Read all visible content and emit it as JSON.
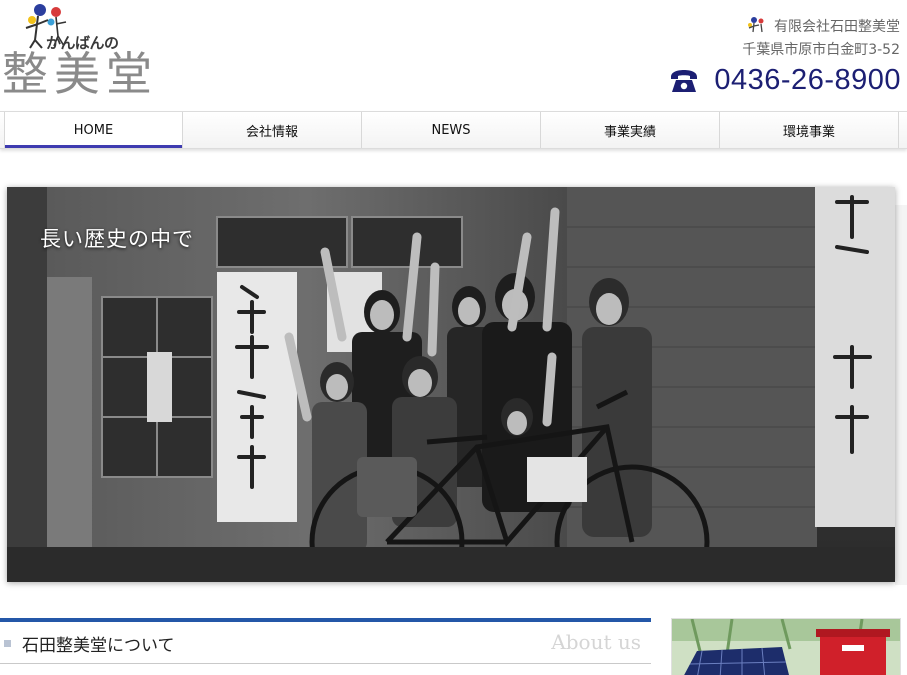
{
  "brand": {
    "logo_sub": "かんばんの",
    "logo_main": "整美堂"
  },
  "company": {
    "name": "有限会社石田整美堂",
    "address": "千葉県市原市白金町3-52",
    "phone": "0436-26-8900",
    "phone_icon": "telephone-icon",
    "logo_icon": "figures-icon"
  },
  "nav": {
    "items": [
      {
        "label": "HOME"
      },
      {
        "label": "会社情報"
      },
      {
        "label": "NEWS"
      },
      {
        "label": "事業実績"
      },
      {
        "label": "環境事業"
      }
    ],
    "active_index": 0,
    "accent": "#3e3bb0"
  },
  "hero": {
    "caption": "長い歴史の中で"
  },
  "about": {
    "title": "石田整美堂について",
    "subtitle": "About us",
    "accent": "#2457a8"
  },
  "colors": {
    "phone": "#1c1f73",
    "gray_text": "#666666"
  }
}
